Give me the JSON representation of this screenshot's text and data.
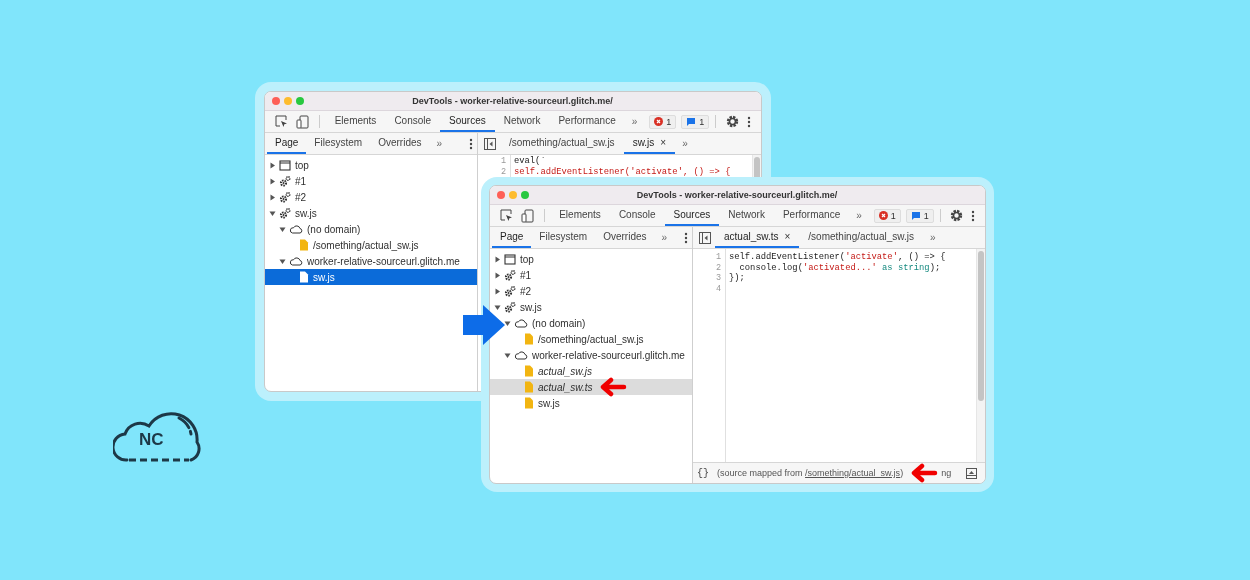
{
  "logo": {
    "text": "NC"
  },
  "windows": [
    {
      "title": "DevTools - worker-relative-sourceurl.glitch.me/",
      "panel_focused": true,
      "toolbar": {
        "tabs": [
          {
            "label": "Elements",
            "selected": false
          },
          {
            "label": "Console",
            "selected": false
          },
          {
            "label": "Sources",
            "selected": true
          },
          {
            "label": "Network",
            "selected": false
          },
          {
            "label": "Performance",
            "selected": false
          }
        ],
        "more": "»",
        "errors": "1",
        "messages": "1"
      },
      "navigator": {
        "tabs": [
          {
            "label": "Page",
            "selected": true
          },
          {
            "label": "Filesystem",
            "selected": false
          },
          {
            "label": "Overrides",
            "selected": false
          }
        ],
        "more": "»",
        "tree": [
          {
            "kind": "frame",
            "label": "top",
            "expanded": false,
            "selected": false
          },
          {
            "kind": "worker",
            "label": "#1",
            "expanded": false,
            "selected": false
          },
          {
            "kind": "worker",
            "label": "#2",
            "expanded": false,
            "selected": false
          },
          {
            "kind": "worker",
            "label": "sw.js",
            "expanded": true,
            "selected": false,
            "children": [
              {
                "kind": "domain",
                "label": "(no domain)",
                "expanded": true,
                "selected": false,
                "children": [
                  {
                    "kind": "file",
                    "label": "/something/actual_sw.js",
                    "selected": false,
                    "italic": false,
                    "callout_arrow": false
                  }
                ]
              },
              {
                "kind": "domain",
                "label": "worker-relative-sourceurl.glitch.me",
                "expanded": true,
                "selected": false,
                "children": [
                  {
                    "kind": "file",
                    "label": "sw.js",
                    "selected": true,
                    "italic": false,
                    "callout_arrow": false
                  }
                ]
              }
            ]
          }
        ]
      },
      "editor": {
        "tabs": [
          {
            "label": "/something/actual_sw.js",
            "selected": false
          },
          {
            "label": "sw.js",
            "selected": true,
            "close": "×"
          }
        ],
        "more": "»",
        "line_numbers": [
          "1",
          "2"
        ],
        "lines": [
          [
            {
              "text": "eval(`",
              "kind": "plain"
            }
          ],
          [
            {
              "text": "self.addEventListener('activate', () => {",
              "kind": "string"
            }
          ]
        ]
      }
    },
    {
      "title": "DevTools - worker-relative-sourceurl.glitch.me/",
      "panel_focused": false,
      "toolbar": {
        "tabs": [
          {
            "label": "Elements",
            "selected": false
          },
          {
            "label": "Console",
            "selected": false
          },
          {
            "label": "Sources",
            "selected": true
          },
          {
            "label": "Network",
            "selected": false
          },
          {
            "label": "Performance",
            "selected": false
          }
        ],
        "more": "»",
        "errors": "1",
        "messages": "1"
      },
      "navigator": {
        "tabs": [
          {
            "label": "Page",
            "selected": true
          },
          {
            "label": "Filesystem",
            "selected": false
          },
          {
            "label": "Overrides",
            "selected": false
          }
        ],
        "more": "»",
        "tree": [
          {
            "kind": "frame",
            "label": "top",
            "expanded": false,
            "selected": false
          },
          {
            "kind": "worker",
            "label": "#1",
            "expanded": false,
            "selected": false
          },
          {
            "kind": "worker",
            "label": "#2",
            "expanded": false,
            "selected": false
          },
          {
            "kind": "worker",
            "label": "sw.js",
            "expanded": true,
            "selected": false,
            "children": [
              {
                "kind": "domain",
                "label": "(no domain)",
                "expanded": true,
                "selected": false,
                "children": [
                  {
                    "kind": "file",
                    "label": "/something/actual_sw.js",
                    "selected": false,
                    "italic": false,
                    "callout_arrow": false
                  }
                ]
              },
              {
                "kind": "domain",
                "label": "worker-relative-sourceurl.glitch.me",
                "expanded": true,
                "selected": false,
                "children": [
                  {
                    "kind": "file",
                    "label": "actual_sw.js",
                    "selected": false,
                    "italic": true,
                    "callout_arrow": false
                  },
                  {
                    "kind": "file",
                    "label": "actual_sw.ts",
                    "selected": true,
                    "italic": true,
                    "callout_arrow": true
                  },
                  {
                    "kind": "file",
                    "label": "sw.js",
                    "selected": false,
                    "italic": false,
                    "callout_arrow": false
                  }
                ]
              }
            ]
          }
        ]
      },
      "editor": {
        "tabs": [
          {
            "label": "actual_sw.ts",
            "selected": true,
            "close": "×"
          },
          {
            "label": "/something/actual_sw.js",
            "selected": false
          }
        ],
        "more": "»",
        "line_numbers": [
          "1",
          "2",
          "3",
          "4"
        ],
        "lines": [
          [
            {
              "text": "self.addEventListener(",
              "kind": "plain"
            },
            {
              "text": "'activate'",
              "kind": "string"
            },
            {
              "text": ", () => {",
              "kind": "plain"
            }
          ],
          [
            {
              "text": "  console.log(",
              "kind": "plain"
            },
            {
              "text": "'activated...'",
              "kind": "string"
            },
            {
              "text": " as ",
              "kind": "keyword"
            },
            {
              "text": "string",
              "kind": "keyword"
            },
            {
              "text": ");",
              "kind": "plain"
            }
          ],
          [
            {
              "text": "});",
              "kind": "plain"
            }
          ]
        ],
        "footer": {
          "format": "{}",
          "status_prefix": "(source mapped from ",
          "link": "/something/actual_sw.js",
          "status_suffix": ")",
          "callout_arrow": true,
          "tail": "ng"
        }
      }
    }
  ]
}
